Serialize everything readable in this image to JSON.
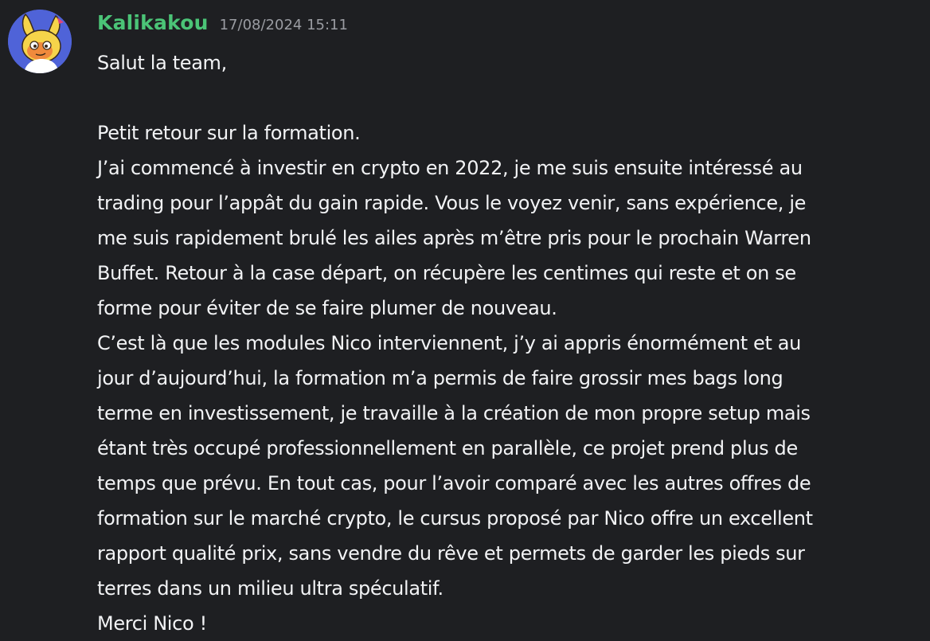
{
  "message": {
    "author": "Kalikakou",
    "timestamp": "17/08/2024 15:11",
    "author_color": "#4bc477",
    "avatar_icon": "bunny-avatar-icon",
    "lines": [
      "Salut la team,",
      "",
      "Petit retour sur la formation.",
      "J’ai commencé à investir en crypto en 2022, je me suis ensuite intéressé au",
      "trading pour l’appât du gain rapide. Vous le voyez venir, sans expérience, je",
      "me suis rapidement brulé les ailes après m’être pris pour le prochain Warren",
      "Buffet.  Retour à la case départ, on récupère les centimes qui reste et on se",
      "forme pour éviter de se faire plumer de nouveau.",
      "C’est là que les modules Nico interviennent, j’y ai appris énormément et au",
      "jour d’aujourd’hui, la formation m’a permis de faire grossir mes bags long",
      "terme en investissement, je travaille à la création de mon propre setup mais",
      "étant très occupé professionnellement en parallèle, ce projet prend plus de",
      "temps que prévu.  En tout cas, pour l’avoir comparé avec les autres offres de",
      "formation sur le marché crypto, le cursus proposé par Nico offre un excellent",
      "rapport qualité prix, sans vendre du rêve et permets de garder les pieds sur",
      "terres dans un milieu ultra spéculatif.",
      "Merci Nico !"
    ]
  }
}
